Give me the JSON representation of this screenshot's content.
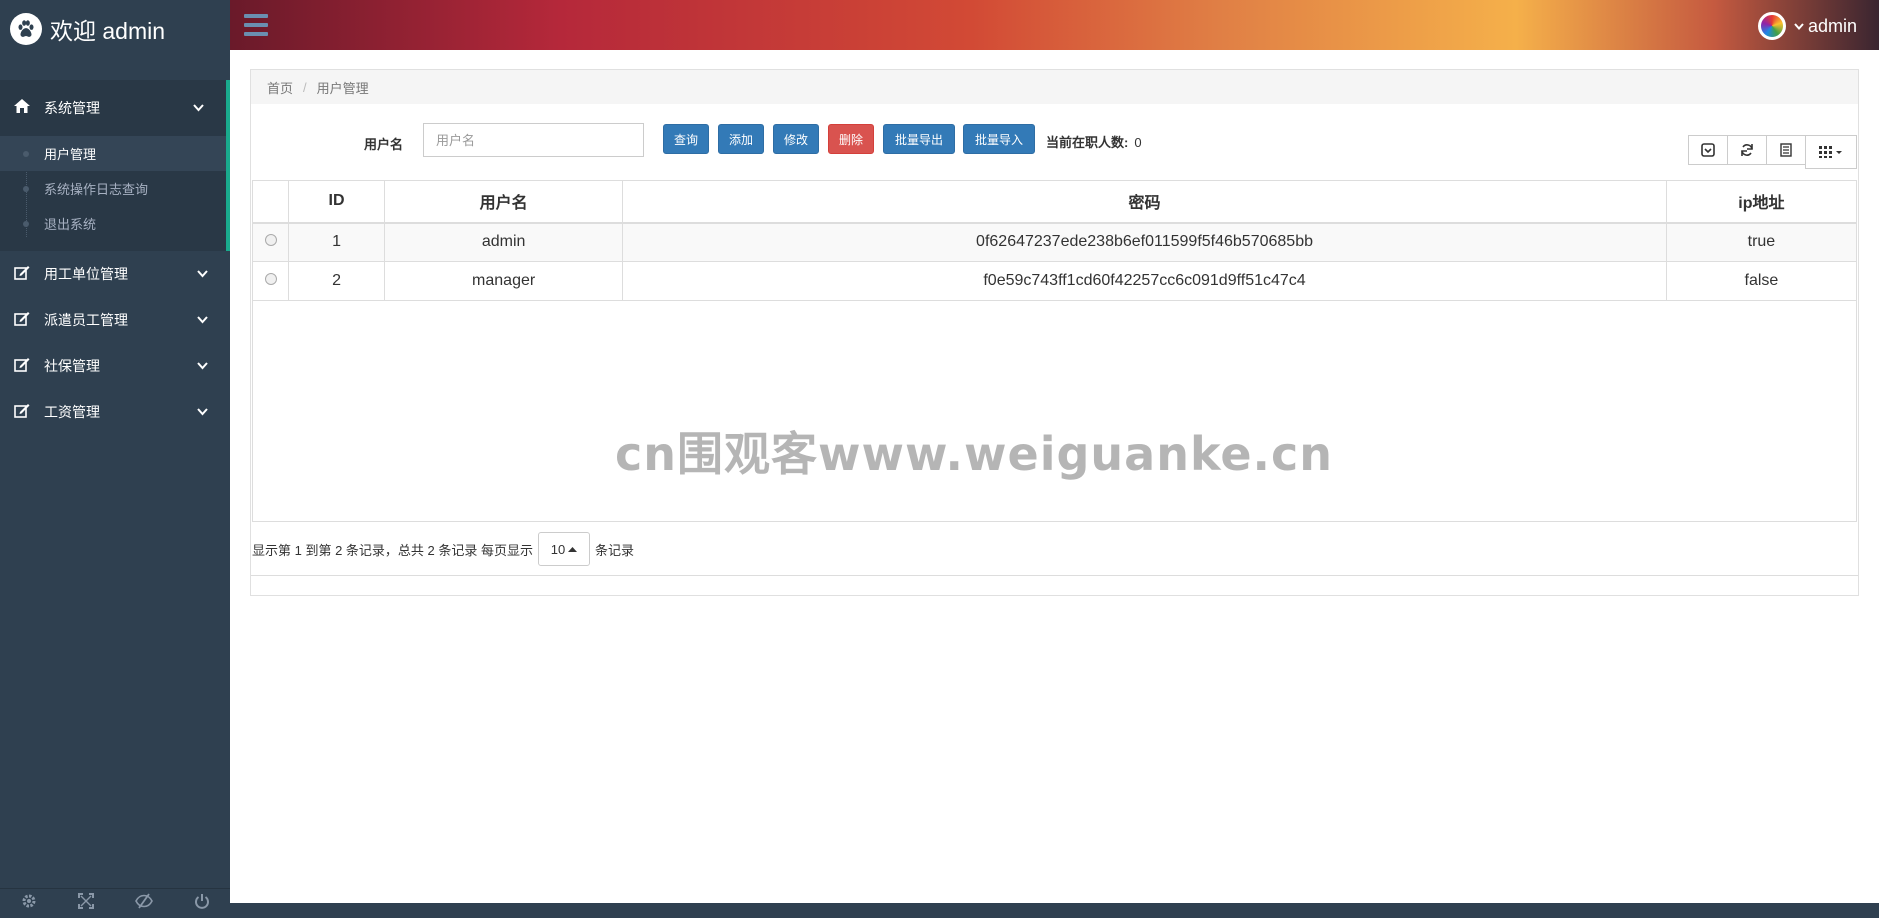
{
  "sidebar": {
    "brand": "欢迎 admin",
    "brand_icon": "paw-icon",
    "menu": [
      {
        "label": "系统管理",
        "icon": "home-icon",
        "items": [
          "用户管理",
          "系统操作日志查询",
          "退出系统"
        ]
      },
      {
        "label": "用工单位管理",
        "icon": "edit-icon"
      },
      {
        "label": "派遣员工管理",
        "icon": "edit-icon"
      },
      {
        "label": "社保管理",
        "icon": "edit-icon"
      },
      {
        "label": "工资管理",
        "icon": "edit-icon"
      }
    ],
    "footer_icons": [
      "gear-icon",
      "fullscreen-icon",
      "eye-slash-icon",
      "power-icon"
    ]
  },
  "topbar": {
    "user": "admin"
  },
  "breadcrumb": {
    "home": "首页",
    "current": "用户管理"
  },
  "toolbar": {
    "label": "用户名",
    "search_placeholder": "用户名",
    "buttons": {
      "query": "查询",
      "add": "添加",
      "edit": "修改",
      "delete": "删除",
      "export": "批量导出",
      "import": "批量导入"
    },
    "count_label": "当前在职人数:",
    "count_value": "0"
  },
  "table": {
    "headers": [
      "ID",
      "用户名",
      "密码",
      "ip地址"
    ],
    "rows": [
      {
        "id": "1",
        "username": "admin",
        "password": "0f62647237ede238b6ef011599f5f46b570685bb",
        "ip": "true"
      },
      {
        "id": "2",
        "username": "manager",
        "password": "f0e59c743ff1cd60f42257cc6c091d9ff51c47c4",
        "ip": "false"
      }
    ]
  },
  "pagination": {
    "summary": "显示第 1 到第 2 条记录，总共 2 条记录 每页显示",
    "page_size": "10",
    "suffix": "条记录"
  },
  "watermark": "cn围观客www.weiguanke.cn",
  "colors": {
    "sidebar": "#2f4050",
    "primary": "#337ab7",
    "danger": "#d9534f",
    "accent": "#19aa8d"
  }
}
